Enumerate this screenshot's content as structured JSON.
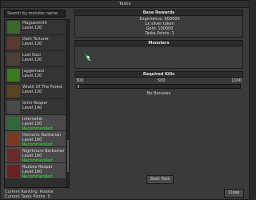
{
  "window": {
    "title": "Tasks"
  },
  "search": {
    "placeholder": "Search by monster name"
  },
  "monsters": [
    {
      "name": "Plaguesmith",
      "level": "Level 120",
      "recommended": "",
      "icon": "plaguesmith-icon",
      "color": "#3a6a2a"
    },
    {
      "name": "Dark Torturer",
      "level": "Level 120",
      "recommended": "",
      "icon": "dark-torturer-icon",
      "color": "#5a3a2a"
    },
    {
      "name": "Lost Soul",
      "level": "Level 120",
      "recommended": "",
      "icon": "lost-soul-icon",
      "color": "#4a4036"
    },
    {
      "name": "Juggernaut",
      "level": "Level 120",
      "recommended": "",
      "icon": "juggernaut-icon",
      "color": "#3a7a20"
    },
    {
      "name": "Wrath Of The Forest",
      "level": "Level 120",
      "recommended": "",
      "icon": "wrath-of-the-forest-icon",
      "color": "#5a4420"
    },
    {
      "name": "Grim Reaper",
      "level": "Level 140",
      "recommended": "",
      "icon": "grim-reaper-icon",
      "color": "#4a4a4a"
    },
    {
      "name": "Infernalist",
      "level": "Level 150",
      "recommended": "Recommended",
      "icon": "infernalist-icon",
      "color": "#2f6a3a"
    },
    {
      "name": "Demonic Barbarian",
      "level": "Level 160",
      "recommended": "Recommended",
      "icon": "demonic-barbarian-icon",
      "color": "#7a3a20"
    },
    {
      "name": "Nightmare Barbarian",
      "level": "Level 160",
      "recommended": "Recommended",
      "icon": "nightmare-barbarian-icon",
      "color": "#6a2a2a"
    },
    {
      "name": "Ruebes Reaper",
      "level": "Level 160",
      "recommended": "Recommended",
      "icon": "ruebes-reaper-icon",
      "color": "#6a2020"
    }
  ],
  "status": {
    "ranking": "Current Ranking: Rookie",
    "points": "Current Tasks Points: 0"
  },
  "base_reward": {
    "title": "Base Rewards",
    "experience": "Experience: 900000",
    "silver": "1x silver token",
    "gold": "Gold: 100000",
    "points": "Tasks Points: 1"
  },
  "monsters_panel": {
    "title": "Monsters",
    "icon": "infernalist-icon"
  },
  "kills": {
    "title": "Required Kills",
    "min_label": "300",
    "mid_label": "500",
    "max_label": "1000",
    "value": 300,
    "min": 300,
    "max": 1000,
    "bonus": "No Bonuses"
  },
  "buttons": {
    "start": "Start Task",
    "close": "Close"
  },
  "colors": {
    "recommended": "#3fdc3f",
    "selected": "#4a4a4a"
  }
}
